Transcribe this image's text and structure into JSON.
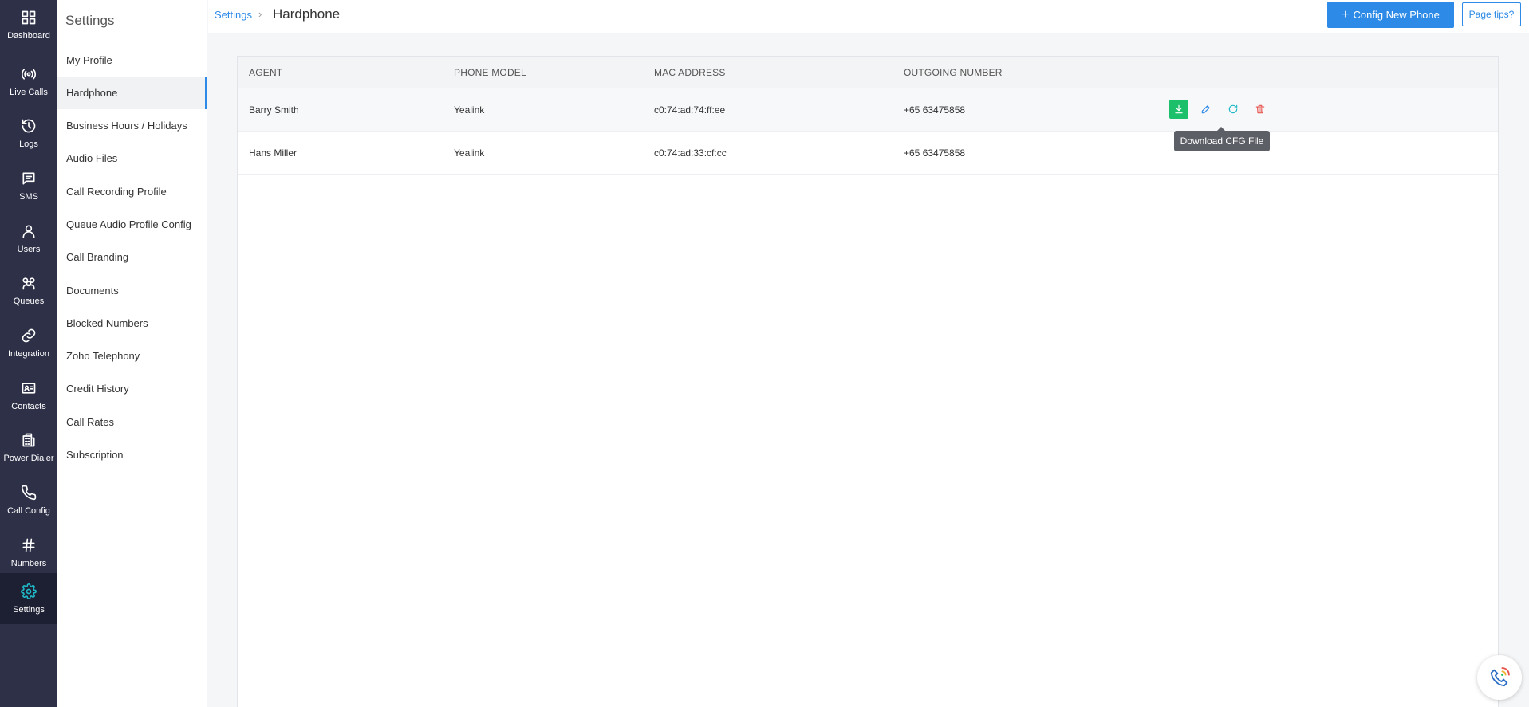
{
  "nav": [
    {
      "label": "Dashboard",
      "icon": "dashboard-icon"
    },
    {
      "label": "Live Calls",
      "icon": "broadcast-icon"
    },
    {
      "label": "Logs",
      "icon": "history-icon"
    },
    {
      "label": "SMS",
      "icon": "message-icon"
    },
    {
      "label": "Users",
      "icon": "user-icon"
    },
    {
      "label": "Queues",
      "icon": "group-icon"
    },
    {
      "label": "Integration",
      "icon": "link-icon"
    },
    {
      "label": "Contacts",
      "icon": "contact-card-icon"
    },
    {
      "label": "Power Dialer",
      "icon": "dialer-icon"
    },
    {
      "label": "Call Config",
      "icon": "phone-icon"
    },
    {
      "label": "Numbers",
      "icon": "hash-icon"
    },
    {
      "label": "Settings",
      "icon": "gear-icon"
    }
  ],
  "submenu": {
    "title": "Settings",
    "items": [
      "My Profile",
      "Hardphone",
      "Business Hours / Holidays",
      "Audio Files",
      "Call Recording Profile",
      "Queue Audio Profile Config",
      "Call Branding",
      "Documents",
      "Blocked Numbers",
      "Zoho Telephony",
      "Credit History",
      "Call Rates",
      "Subscription"
    ],
    "active": "Hardphone"
  },
  "header": {
    "breadcrumb_root": "Settings",
    "breadcrumb_separator": "›",
    "page_title": "Hardphone",
    "primary_plus": "+",
    "primary_button": "Config New Phone",
    "tips_button": "Page tips?"
  },
  "table": {
    "columns": [
      "AGENT",
      "PHONE MODEL",
      "MAC ADDRESS",
      "OUTGOING NUMBER"
    ],
    "rows": [
      {
        "agent": "Barry Smith",
        "model": "Yealink",
        "mac": "c0:74:ad:74:ff:ee",
        "number": "+65 63475858"
      },
      {
        "agent": "Hans Miller",
        "model": "Yealink",
        "mac": "c0:74:ad:33:cf:cc",
        "number": "+65 63475858"
      }
    ]
  },
  "tooltip": "Download CFG File",
  "colors": {
    "rail": "#2e3048",
    "accent": "#2d8ae6",
    "download": "#1cc06a",
    "delete": "#e8544e",
    "refresh": "#1fb8c7"
  }
}
